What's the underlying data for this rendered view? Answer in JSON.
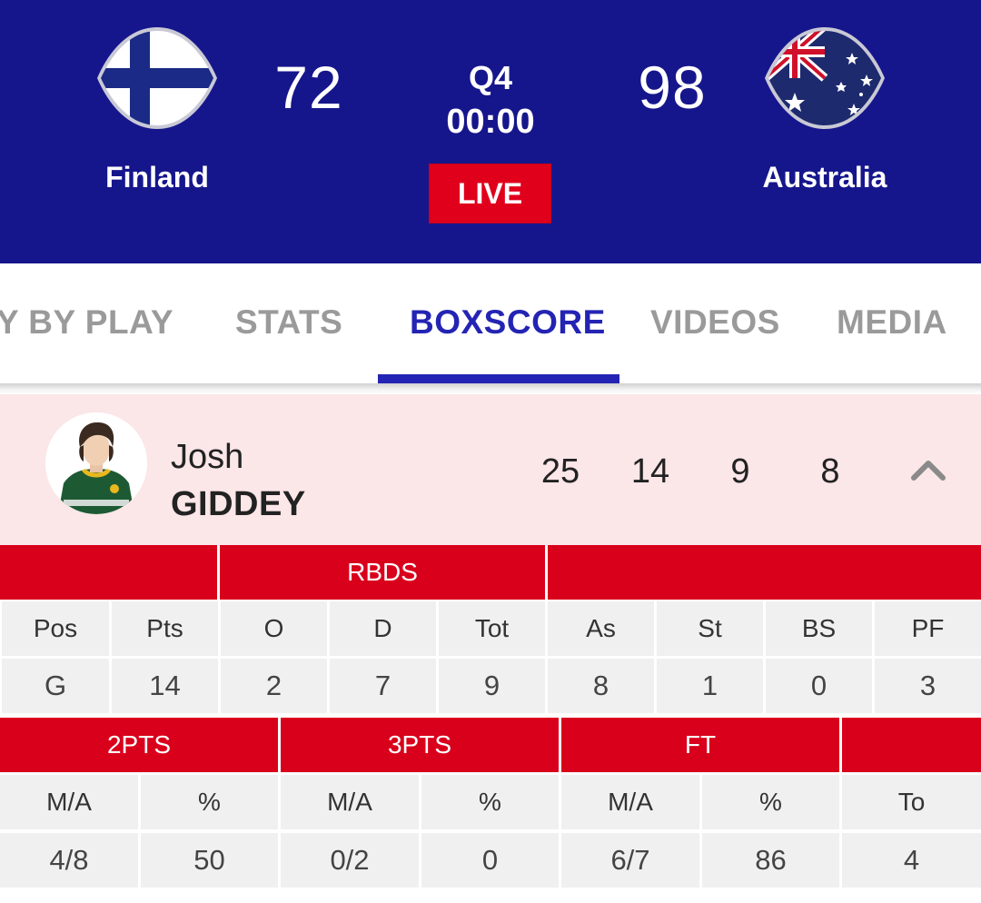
{
  "game": {
    "home": {
      "name": "Finland",
      "score": "72",
      "flag": "finland-flag-icon"
    },
    "away": {
      "name": "Australia",
      "score": "98",
      "flag": "australia-flag-icon"
    },
    "quarter": "Q4",
    "clock": "00:00",
    "status": "LIVE"
  },
  "tabs": [
    {
      "label": "PLAY BY PLAY",
      "shown": "Y BY PLAY",
      "active": false
    },
    {
      "label": "STATS",
      "active": false
    },
    {
      "label": "BOXSCORE",
      "active": true
    },
    {
      "label": "VIDEOS",
      "active": false
    },
    {
      "label": "MEDIA",
      "active": false
    }
  ],
  "player": {
    "first_name": "Josh",
    "last_name": "GIDDEY",
    "summary": [
      "25",
      "14",
      "9",
      "8"
    ],
    "expanded": true
  },
  "table1": {
    "group_header": "RBDS",
    "headers": [
      "Pos",
      "Pts",
      "O",
      "D",
      "Tot",
      "As",
      "St",
      "BS",
      "PF"
    ],
    "values": [
      "G",
      "14",
      "2",
      "7",
      "9",
      "8",
      "1",
      "0",
      "3"
    ]
  },
  "table2": {
    "group_headers": [
      "2PTS",
      "3PTS",
      "FT",
      ""
    ],
    "headers": [
      "M/A",
      "%",
      "M/A",
      "%",
      "M/A",
      "%",
      "To"
    ],
    "values": [
      "4/8",
      "50",
      "0/2",
      "0",
      "6/7",
      "86",
      "4"
    ]
  },
  "colors": {
    "header_bg": "#16168c",
    "accent": "#2424b4",
    "live_red": "#e0001b",
    "table_red": "#d9001b",
    "player_row_bg": "#fbe6e8"
  }
}
